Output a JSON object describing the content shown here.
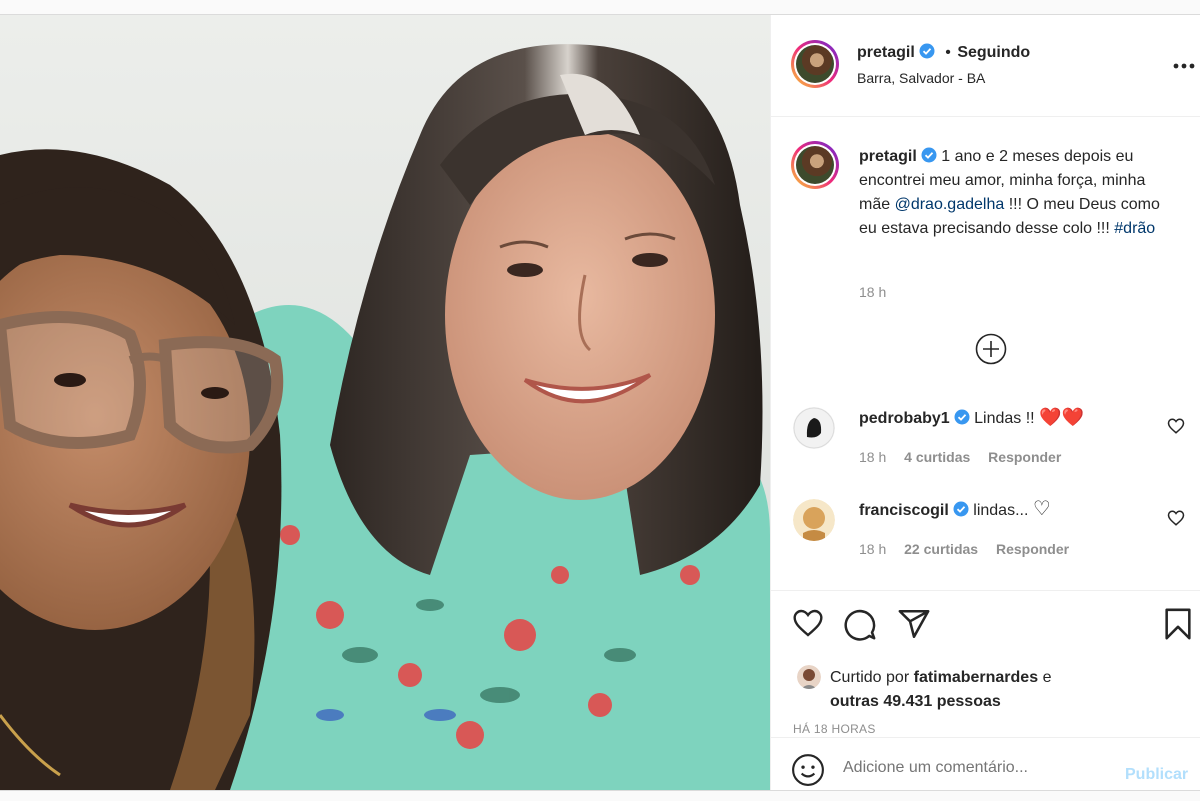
{
  "post": {
    "username": "pretagil",
    "follow_status": "Seguindo",
    "separator": "•",
    "location": "Barra, Salvador - BA",
    "more_icon": "more-horizontal-icon"
  },
  "caption": {
    "username": "pretagil",
    "text_part1": "1 ano e 2 meses depois eu encontrei meu amor, minha força, minha mãe",
    "mention": "@drao.gadelha",
    "text_part2": "!!! O meu Deus como eu estava precisando desse colo !!!",
    "hashtag": "#drão",
    "time": "18 h"
  },
  "load_more_icon": "plus-circle-icon",
  "comments": [
    {
      "username": "pedrobaby1",
      "text": "Lindas !!",
      "emoji": "❤️❤️",
      "time": "18 h",
      "likes": "4 curtidas",
      "reply": "Responder"
    },
    {
      "username": "franciscogil",
      "text": "lindas...",
      "emoji": "♡",
      "time": "18 h",
      "likes": "22 curtidas",
      "reply": "Responder"
    }
  ],
  "likes": {
    "prefix": "Curtido por",
    "user": "fatimabernardes",
    "conj": "e",
    "others": "outras 49.431 pessoas"
  },
  "timestamp": "HÁ 18 HORAS",
  "add_comment": {
    "placeholder": "Adicione um comentário...",
    "publish": "Publicar"
  },
  "colors": {
    "link": "#00376b",
    "verified": "#3897f0",
    "publish_disabled": "#b2dffc",
    "heart": "#ed4956"
  }
}
